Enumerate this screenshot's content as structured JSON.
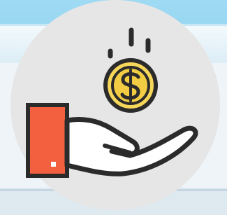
{
  "icon": {
    "name": "hand-receiving-coin-icon",
    "symbol": "$"
  },
  "colors": {
    "sky_top": "#8fd3f0",
    "sky_band": "#6ec6ec",
    "banner": "#e9f5fb",
    "banner_shadow": "#b8dff2",
    "snow": "#f4f8fb",
    "circle": "#e6e6e6",
    "outline": "#2b2b2b",
    "coin_fill": "#f6d75a",
    "coin_inner": "#f0c93c",
    "cuff": "#f2603f",
    "hand": "#ffffff"
  }
}
